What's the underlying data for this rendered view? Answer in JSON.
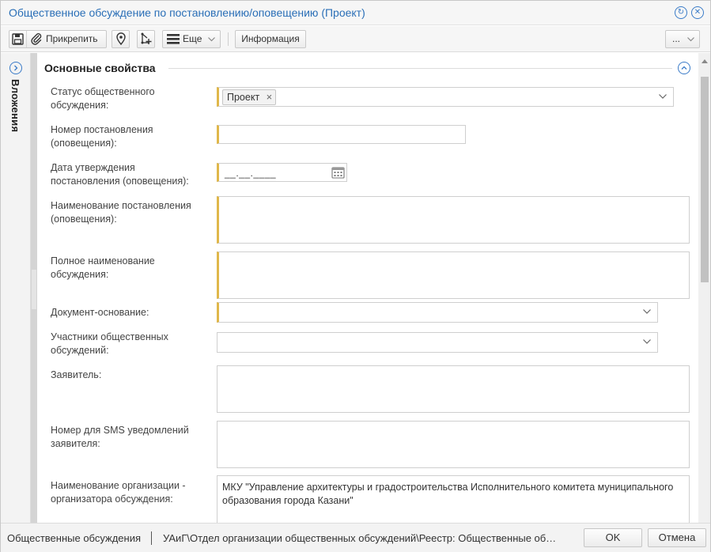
{
  "window": {
    "title": "Общественное обсуждение по постановлению/оповещению (Проект)"
  },
  "toolbar": {
    "attach_label": "Прикрепить",
    "more_label": "Еще",
    "info_label": "Информация",
    "overflow_label": "..."
  },
  "sidepanel": {
    "label": "Вложения"
  },
  "section": {
    "title": "Основные свойства"
  },
  "fields": {
    "status_label": "Статус общественного обсуждения:",
    "status_value": "Проект",
    "resolution_number_label": "Номер постановления (оповещения):",
    "approval_date_label": "Дата утверждения постановления (оповещения):",
    "approval_date_mask": "__.__.____",
    "resolution_name_label": "Наименование постановления (оповещения):",
    "full_name_label": "Полное наименование обсуждения:",
    "base_document_label": "Документ-основание:",
    "participants_label": "Участники общественных обсуждений:",
    "applicant_label": "Заявитель:",
    "sms_number_label": "Номер для SMS уведомлений заявителя:",
    "organizer_label": "Наименование организации - организатора обсуждения:",
    "organizer_value": "МКУ \"Управление архитектуры и градостроительства Исполнительного комитета муниципального образования города Казани\""
  },
  "statusbar": {
    "module": "Общественные обсуждения",
    "path": "УАиГ\\Отдел организации общественных обсуждений\\Реестр: Общественные обсуждения",
    "ok_label": "OK",
    "cancel_label": "Отмена"
  },
  "colors": {
    "accent": "#2a6fb7",
    "required_marker": "#e0b74a"
  }
}
